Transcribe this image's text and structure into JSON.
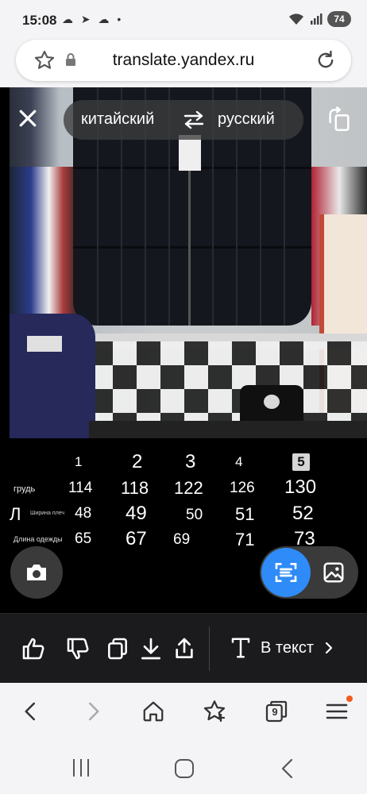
{
  "status_bar": {
    "time": "15:08",
    "left_icons": "☁ ➤ ☁ •",
    "battery": "74"
  },
  "url_bar": {
    "url": "translate.yandex.ru"
  },
  "translator": {
    "source_lang": "китайский",
    "target_lang": "русский"
  },
  "size_table": {
    "sizes": [
      "1",
      "2",
      "3",
      "4",
      "5"
    ],
    "rows": [
      {
        "label": "грудь",
        "values": [
          "114",
          "118",
          "122",
          "126",
          "130"
        ]
      },
      {
        "label": "Ширина плеч",
        "prefix": "Л",
        "values": [
          "48",
          "49",
          "50",
          "51",
          "52"
        ]
      },
      {
        "label": "Длина одежды",
        "values": [
          "65",
          "67",
          "69",
          "71",
          "73"
        ]
      }
    ]
  },
  "toolbar": {
    "to_text_label": "В текст"
  },
  "browser_nav": {
    "tabs_count": "9"
  },
  "colors": {
    "accent": "#2f8bf7",
    "notification": "#f25a1c"
  }
}
